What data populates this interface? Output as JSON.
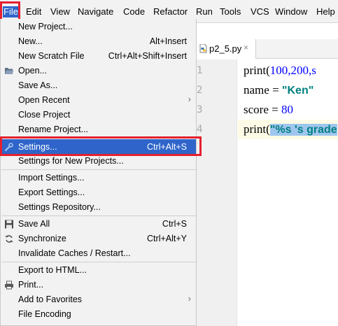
{
  "menubar": {
    "items": [
      "File",
      "Edit",
      "View",
      "Navigate",
      "Code",
      "Refactor",
      "Run",
      "Tools",
      "VCS",
      "Window",
      "Help"
    ]
  },
  "editor": {
    "tab_label": "p2_5.py",
    "tab_close": "×",
    "line_numbers": [
      "1",
      "2",
      "3",
      "4"
    ],
    "lines": [
      {
        "pre": "print(",
        "num": "100,200,s",
        "str": "",
        "post": ""
      },
      {
        "pre": "name = ",
        "num": "",
        "str": "\"Ken\"",
        "post": ""
      },
      {
        "pre": "score = ",
        "num": "80",
        "str": "",
        "post": ""
      },
      {
        "pre": "print(",
        "num": "",
        "str": "\"%s 's grade",
        "post": ""
      }
    ]
  },
  "file_menu": {
    "items": [
      {
        "label": "New Project...",
        "shortcut": ""
      },
      {
        "label": "New...",
        "shortcut": "Alt+Insert"
      },
      {
        "label": "New Scratch File",
        "shortcut": "Ctrl+Alt+Shift+Insert"
      },
      {
        "label": "Open...",
        "shortcut": ""
      },
      {
        "label": "Save As...",
        "shortcut": ""
      },
      {
        "label": "Open Recent",
        "shortcut": ""
      },
      {
        "label": "Close Project",
        "shortcut": ""
      },
      {
        "label": "Rename Project...",
        "shortcut": ""
      },
      {
        "label": "Settings...",
        "shortcut": "Ctrl+Alt+S"
      },
      {
        "label": "Settings for New Projects...",
        "shortcut": ""
      },
      {
        "label": "Import Settings...",
        "shortcut": ""
      },
      {
        "label": "Export Settings...",
        "shortcut": ""
      },
      {
        "label": "Settings Repository...",
        "shortcut": ""
      },
      {
        "label": "Save All",
        "shortcut": "Ctrl+S"
      },
      {
        "label": "Synchronize",
        "shortcut": "Ctrl+Alt+Y"
      },
      {
        "label": "Invalidate Caches / Restart...",
        "shortcut": ""
      },
      {
        "label": "Export to HTML...",
        "shortcut": ""
      },
      {
        "label": "Print...",
        "shortcut": ""
      },
      {
        "label": "Add to Favorites",
        "shortcut": ""
      },
      {
        "label": "File Encoding",
        "shortcut": ""
      }
    ],
    "submenu_arrow": "›"
  },
  "colors": {
    "highlight": "#2f65ca",
    "annotation": "#e5202e"
  }
}
